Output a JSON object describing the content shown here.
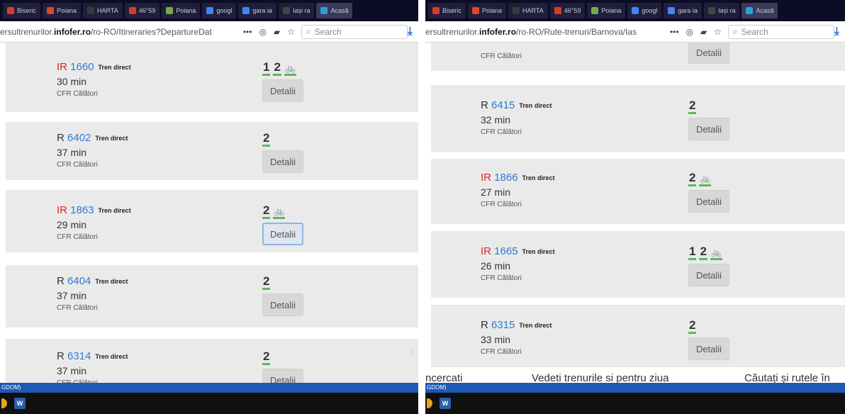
{
  "left": {
    "tabs": [
      {
        "label": "Biseric",
        "color": "#d93a2b"
      },
      {
        "label": "Poiana",
        "color": "#e0452c"
      },
      {
        "label": "HARTA",
        "color": "#3a3a3a"
      },
      {
        "label": "46°59",
        "color": "#d93a2b"
      },
      {
        "label": "Poiana",
        "color": "#7aa84a"
      },
      {
        "label": "googl",
        "color": "#4285f4"
      },
      {
        "label": "gara ia",
        "color": "#4285f4"
      },
      {
        "label": "Iași ra",
        "color": "#444"
      },
      {
        "label": "Acasă",
        "color": "#2aa0d8"
      }
    ],
    "url_prefix": "ersultrenurilor.",
    "url_domain": "infofer.ro",
    "url_path": "/ro-RO/Itineraries?DepartureDat",
    "search_placeholder": "Search",
    "status_text": "GDOM)",
    "trains": [
      {
        "category": "IR",
        "number": "1660",
        "direct": "Tren direct",
        "duration": "30 min",
        "operator": "CFR Călători",
        "classes": [
          "1",
          "2"
        ],
        "bike": true,
        "button": "Detalii"
      },
      {
        "category": "R",
        "number": "6402",
        "direct": "Tren direct",
        "duration": "37 min",
        "operator": "CFR Călători",
        "classes": [
          "2"
        ],
        "bike": false,
        "button": "Detalii"
      },
      {
        "category": "IR",
        "number": "1863",
        "direct": "Tren direct",
        "duration": "29 min",
        "operator": "CFR Călători",
        "classes": [
          "2"
        ],
        "bike": true,
        "button": "Detalii"
      },
      {
        "category": "R",
        "number": "6404",
        "direct": "Tren direct",
        "duration": "37 min",
        "operator": "CFR Călători",
        "classes": [
          "2"
        ],
        "bike": false,
        "button": "Detalii"
      },
      {
        "category": "R",
        "number": "6314",
        "direct": "Tren direct",
        "duration": "37 min",
        "operator": "CFR Călători",
        "classes": [
          "2"
        ],
        "bike": false,
        "button": "Detalii"
      }
    ]
  },
  "right": {
    "tabs": [
      {
        "label": "Biseric",
        "color": "#d93a2b"
      },
      {
        "label": "Poiana",
        "color": "#e0452c"
      },
      {
        "label": "HARTA",
        "color": "#3a3a3a"
      },
      {
        "label": "46°59",
        "color": "#d93a2b"
      },
      {
        "label": "Poiana",
        "color": "#7aa84a"
      },
      {
        "label": "googl",
        "color": "#4285f4"
      },
      {
        "label": "gara ia",
        "color": "#4285f4"
      },
      {
        "label": "Iași ra",
        "color": "#444"
      },
      {
        "label": "Acasă",
        "color": "#2aa0d8"
      }
    ],
    "url_prefix": "ersultrenurilor.",
    "url_domain": "infofer.ro",
    "url_path": "/ro-RO/Rute-trenuri/Barnova/Ias",
    "search_placeholder": "Search",
    "status_text": "GDOM)",
    "top_card": {
      "operator": "CFR Călători",
      "button": "Detalii"
    },
    "trains": [
      {
        "category": "R",
        "number": "6415",
        "direct": "Tren direct",
        "duration": "32 min",
        "operator": "CFR Călători",
        "classes": [
          "2"
        ],
        "bike": false,
        "button": "Detalii"
      },
      {
        "category": "IR",
        "number": "1866",
        "direct": "Tren direct",
        "duration": "27 min",
        "operator": "CFR Călători",
        "classes": [
          "2"
        ],
        "bike": true,
        "button": "Detalii"
      },
      {
        "category": "IR",
        "number": "1665",
        "direct": "Tren direct",
        "duration": "26 min",
        "operator": "CFR Călători",
        "classes": [
          "1",
          "2"
        ],
        "bike": true,
        "button": "Detalii"
      },
      {
        "category": "R",
        "number": "6315",
        "direct": "Tren direct",
        "duration": "33 min",
        "operator": "CFR Călători",
        "classes": [
          "2"
        ],
        "bike": false,
        "button": "Detalii"
      }
    ],
    "promo": [
      "ncercati",
      "Vedeti trenurile si pentru ziua",
      "Căutați și rutele în"
    ]
  },
  "taskbar": {
    "word_label": "W"
  }
}
